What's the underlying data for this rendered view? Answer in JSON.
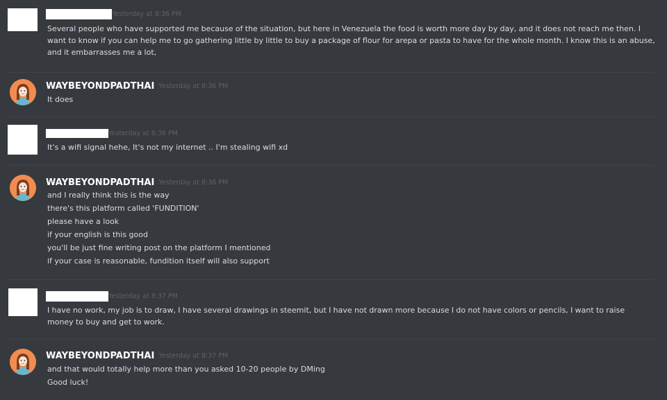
{
  "messages": [
    {
      "author": "",
      "author_redacted": true,
      "timestamp": "Yesterday at 8:36 PM",
      "lines": [
        "Several people who have supported me because of the situation, but here in Venezuela the food is worth more day by day, and it does not reach me then. I want to know if you can help me to go gathering little by little to buy a package of flour for arepa or pasta to have for the whole month. I know this is an abuse, and it embarrasses me a lot,"
      ]
    },
    {
      "author": "WAYBEYONDPADTHAI",
      "author_redacted": false,
      "timestamp": "Yesterday at 8:36 PM",
      "lines": [
        "It does"
      ]
    },
    {
      "author": "",
      "author_redacted": true,
      "timestamp": "Yesterday at 8:36 PM",
      "lines": [
        "It's a wifi signal hehe, It's not my internet .. I'm stealing wifi xd"
      ]
    },
    {
      "author": "WAYBEYONDPADTHAI",
      "author_redacted": false,
      "timestamp": "Yesterday at 8:36 PM",
      "lines": [
        "and I really think this is the way",
        "there's this platform called 'FUNDITION'",
        "please have a look",
        "if your english is this good",
        "you'll be just fine writing post on the platform I mentioned",
        "if your case is reasonable, fundition itself will also support"
      ]
    },
    {
      "author": "",
      "author_redacted": true,
      "timestamp": "Yesterday at 8:37 PM",
      "lines": [
        "I have no work, my job is to draw, I have several drawings in steemit, but I have not drawn more because I do not have colors or pencils, I want to raise money to buy and get to work."
      ]
    },
    {
      "author": "WAYBEYONDPADTHAI",
      "author_redacted": false,
      "timestamp": "Yesterday at 8:37 PM",
      "lines": [
        "and that would totally help more than you asked 10-20 people by DMing",
        "Good luck!"
      ]
    }
  ],
  "colors": {
    "background": "#36393e",
    "text": "#dcddde",
    "username": "#ffffff",
    "timestamp": "#5e6166",
    "avatar_bg": "#f28c4e"
  },
  "icons": {
    "avatar": "girl-avatar-icon"
  }
}
